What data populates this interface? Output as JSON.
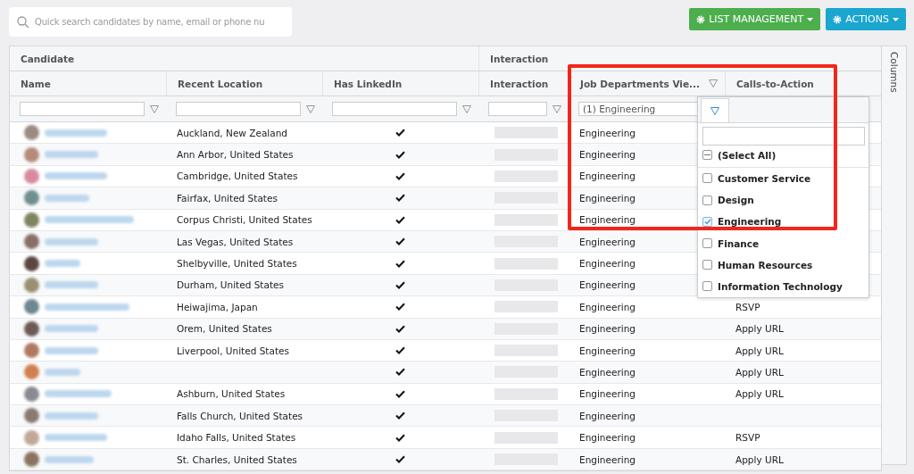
{
  "search": {
    "placeholder": "Quick search candidates by name, email or phone nu"
  },
  "buttons": [
    {
      "label": "LIST MANAGEMENT",
      "kind": "success"
    },
    {
      "label": "ACTIONS",
      "kind": "info"
    }
  ],
  "column_groups": [
    "Candidate",
    "Interaction"
  ],
  "columns": [
    {
      "label": "Name",
      "filter_icon": false
    },
    {
      "label": "Recent Location",
      "filter_icon": false
    },
    {
      "label": "Has LinkedIn",
      "filter_icon": false
    },
    {
      "label": "Interaction",
      "filter_icon": false
    },
    {
      "label": "Job Departments Vie...",
      "filter_icon": true,
      "filter_value": "(1) Engineering"
    },
    {
      "label": "Calls-to-Action",
      "filter_icon": false
    }
  ],
  "rows": [
    {
      "location": "Auckland, New Zealand",
      "linkedin": true,
      "department": "Engineering"
    },
    {
      "location": "Ann Arbor, United States",
      "linkedin": true,
      "department": "Engineering"
    },
    {
      "location": "Cambridge, United States",
      "linkedin": true,
      "department": "Engineering"
    },
    {
      "location": "Fairfax, United States",
      "linkedin": true,
      "department": "Engineering"
    },
    {
      "location": "Corpus Christi, United States",
      "linkedin": true,
      "department": "Engineering"
    },
    {
      "location": "Las Vegas, United States",
      "linkedin": true,
      "department": "Engineering"
    },
    {
      "location": "Shelbyville, United States",
      "linkedin": true,
      "department": "Engineering"
    },
    {
      "location": "Durham, United States",
      "linkedin": true,
      "department": "Engineering"
    },
    {
      "location": "Heiwajima, Japan",
      "linkedin": true,
      "department": "Engineering",
      "cta": "RSVP"
    },
    {
      "location": "Orem, United States",
      "linkedin": true,
      "department": "Engineering",
      "cta": "Apply URL"
    },
    {
      "location": "Liverpool, United States",
      "linkedin": true,
      "department": "Engineering",
      "cta": "Apply URL"
    },
    {
      "location": "",
      "linkedin": true,
      "department": "Engineering",
      "cta": "Apply URL"
    },
    {
      "location": "Ashburn, United States",
      "linkedin": true,
      "department": "Engineering",
      "cta": "Apply URL"
    },
    {
      "location": "Falls Church, United States",
      "linkedin": true,
      "department": "Engineering"
    },
    {
      "location": "Idaho Falls, United States",
      "linkedin": true,
      "department": "Engineering",
      "cta": "RSVP"
    },
    {
      "location": "St. Charles, United States",
      "linkedin": true,
      "department": "Engineering",
      "cta": "Apply URL"
    }
  ],
  "filter_menu": {
    "select_all": {
      "label": "(Select All)",
      "indeterminate": true
    },
    "options": [
      {
        "label": "Customer Service",
        "checked": false
      },
      {
        "label": "Design",
        "checked": false
      },
      {
        "label": "Engineering",
        "checked": true
      },
      {
        "label": "Finance",
        "checked": false
      },
      {
        "label": "Human Resources",
        "checked": false
      },
      {
        "label": "Information Technology",
        "checked": false
      }
    ]
  },
  "side_panel": {
    "label": "Columns"
  }
}
